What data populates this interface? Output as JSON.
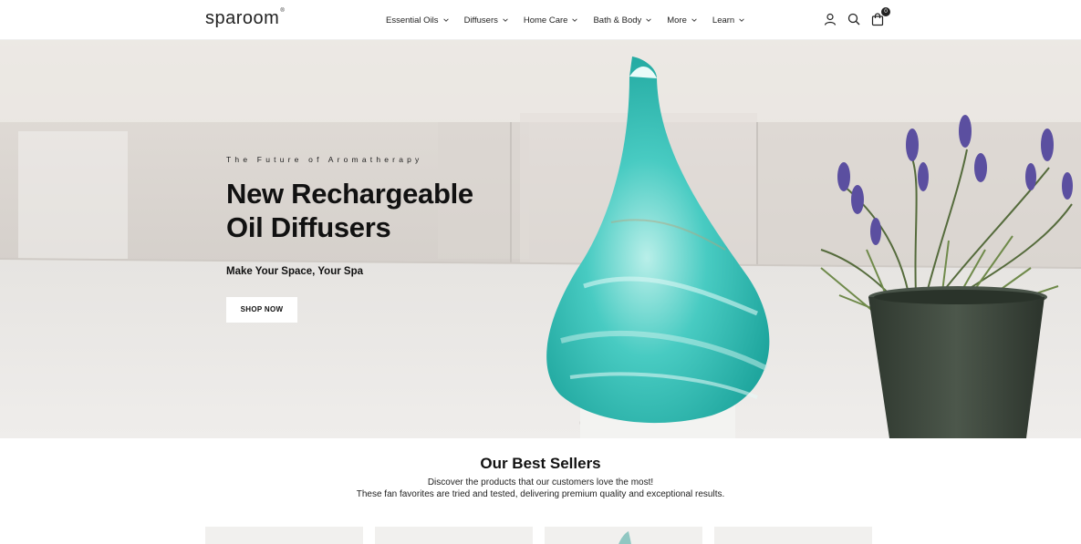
{
  "brand": {
    "logo_text": "sparoom",
    "logo_mark": "®"
  },
  "nav": {
    "items": [
      {
        "label": "Essential Oils"
      },
      {
        "label": "Diffusers"
      },
      {
        "label": "Home Care"
      },
      {
        "label": "Bath & Body"
      },
      {
        "label": "More"
      },
      {
        "label": "Learn"
      }
    ]
  },
  "header_icons": {
    "account": "user-icon",
    "search": "search-icon",
    "cart": "shopping-bag-icon",
    "cart_count": "0"
  },
  "hero": {
    "eyebrow": "The Future of Aromatherapy",
    "headline_line1": "New Rechargeable",
    "headline_line2": "Oil Diffusers",
    "subheading": "Make Your Space, Your Spa",
    "cta_label": "SHOP NOW"
  },
  "best_sellers": {
    "title": "Our Best Sellers",
    "description_line1": "Discover the products that our customers love the most!",
    "description_line2": "These fan favorites are tried and tested, delivering premium quality and exceptional results."
  },
  "colors": {
    "text": "#111111",
    "diffuser_teal": "#3cc7bf",
    "lavender": "#5b4fa0",
    "pot": "#3f4a3f"
  }
}
